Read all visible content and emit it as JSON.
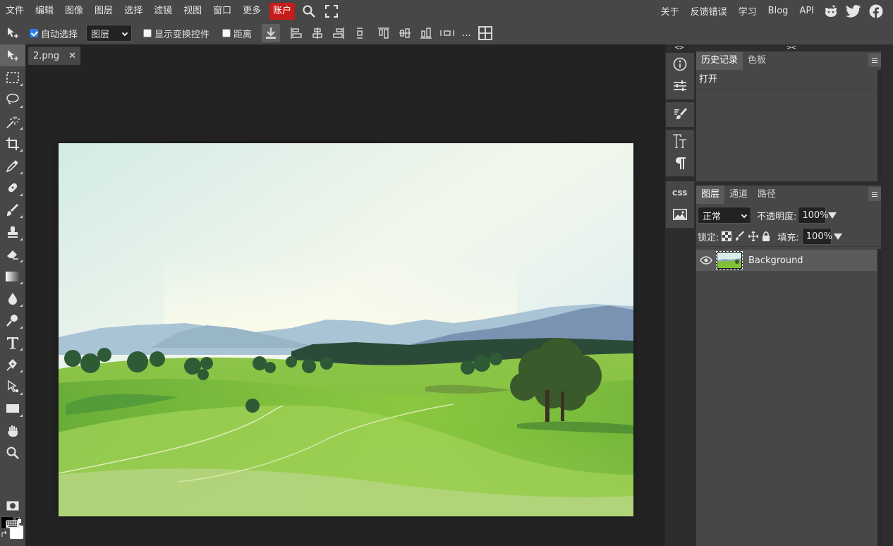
{
  "menu": {
    "items": [
      "文件",
      "编辑",
      "图像",
      "图层",
      "选择",
      "滤镜",
      "视图",
      "窗口",
      "更多"
    ],
    "account": "账户",
    "right": [
      "关于",
      "反馈错误",
      "学习",
      "Blog",
      "API"
    ],
    "icons": [
      "search-icon",
      "fullscreen-icon"
    ],
    "social": [
      "reddit-icon",
      "twitter-icon",
      "facebook-icon"
    ]
  },
  "options": {
    "auto_select": {
      "label": "自动选择",
      "checked": true
    },
    "target": "图层",
    "show_transform": {
      "label": "显示变换控件",
      "checked": false
    },
    "distance": {
      "label": "距离",
      "checked": false
    },
    "more": "..."
  },
  "document": {
    "tab_name": "2.png",
    "close": "✕"
  },
  "history_panel": {
    "tabs": [
      "历史记录",
      "色板"
    ],
    "active_tab": "历史记录",
    "items": [
      "打开"
    ]
  },
  "layers_panel": {
    "tabs": [
      "图层",
      "通道",
      "路径"
    ],
    "active_tab": "图层",
    "blend_mode": "正常",
    "opacity_label": "不透明度:",
    "opacity": "100%",
    "lock_label": "锁定:",
    "fill_label": "填充:",
    "fill": "100%",
    "layers": [
      {
        "name": "Background",
        "visible": true
      }
    ]
  },
  "colors": {
    "accent": "#c81c1c",
    "foreground": "#000000",
    "background": "#ffffff",
    "ui": "#474747"
  }
}
